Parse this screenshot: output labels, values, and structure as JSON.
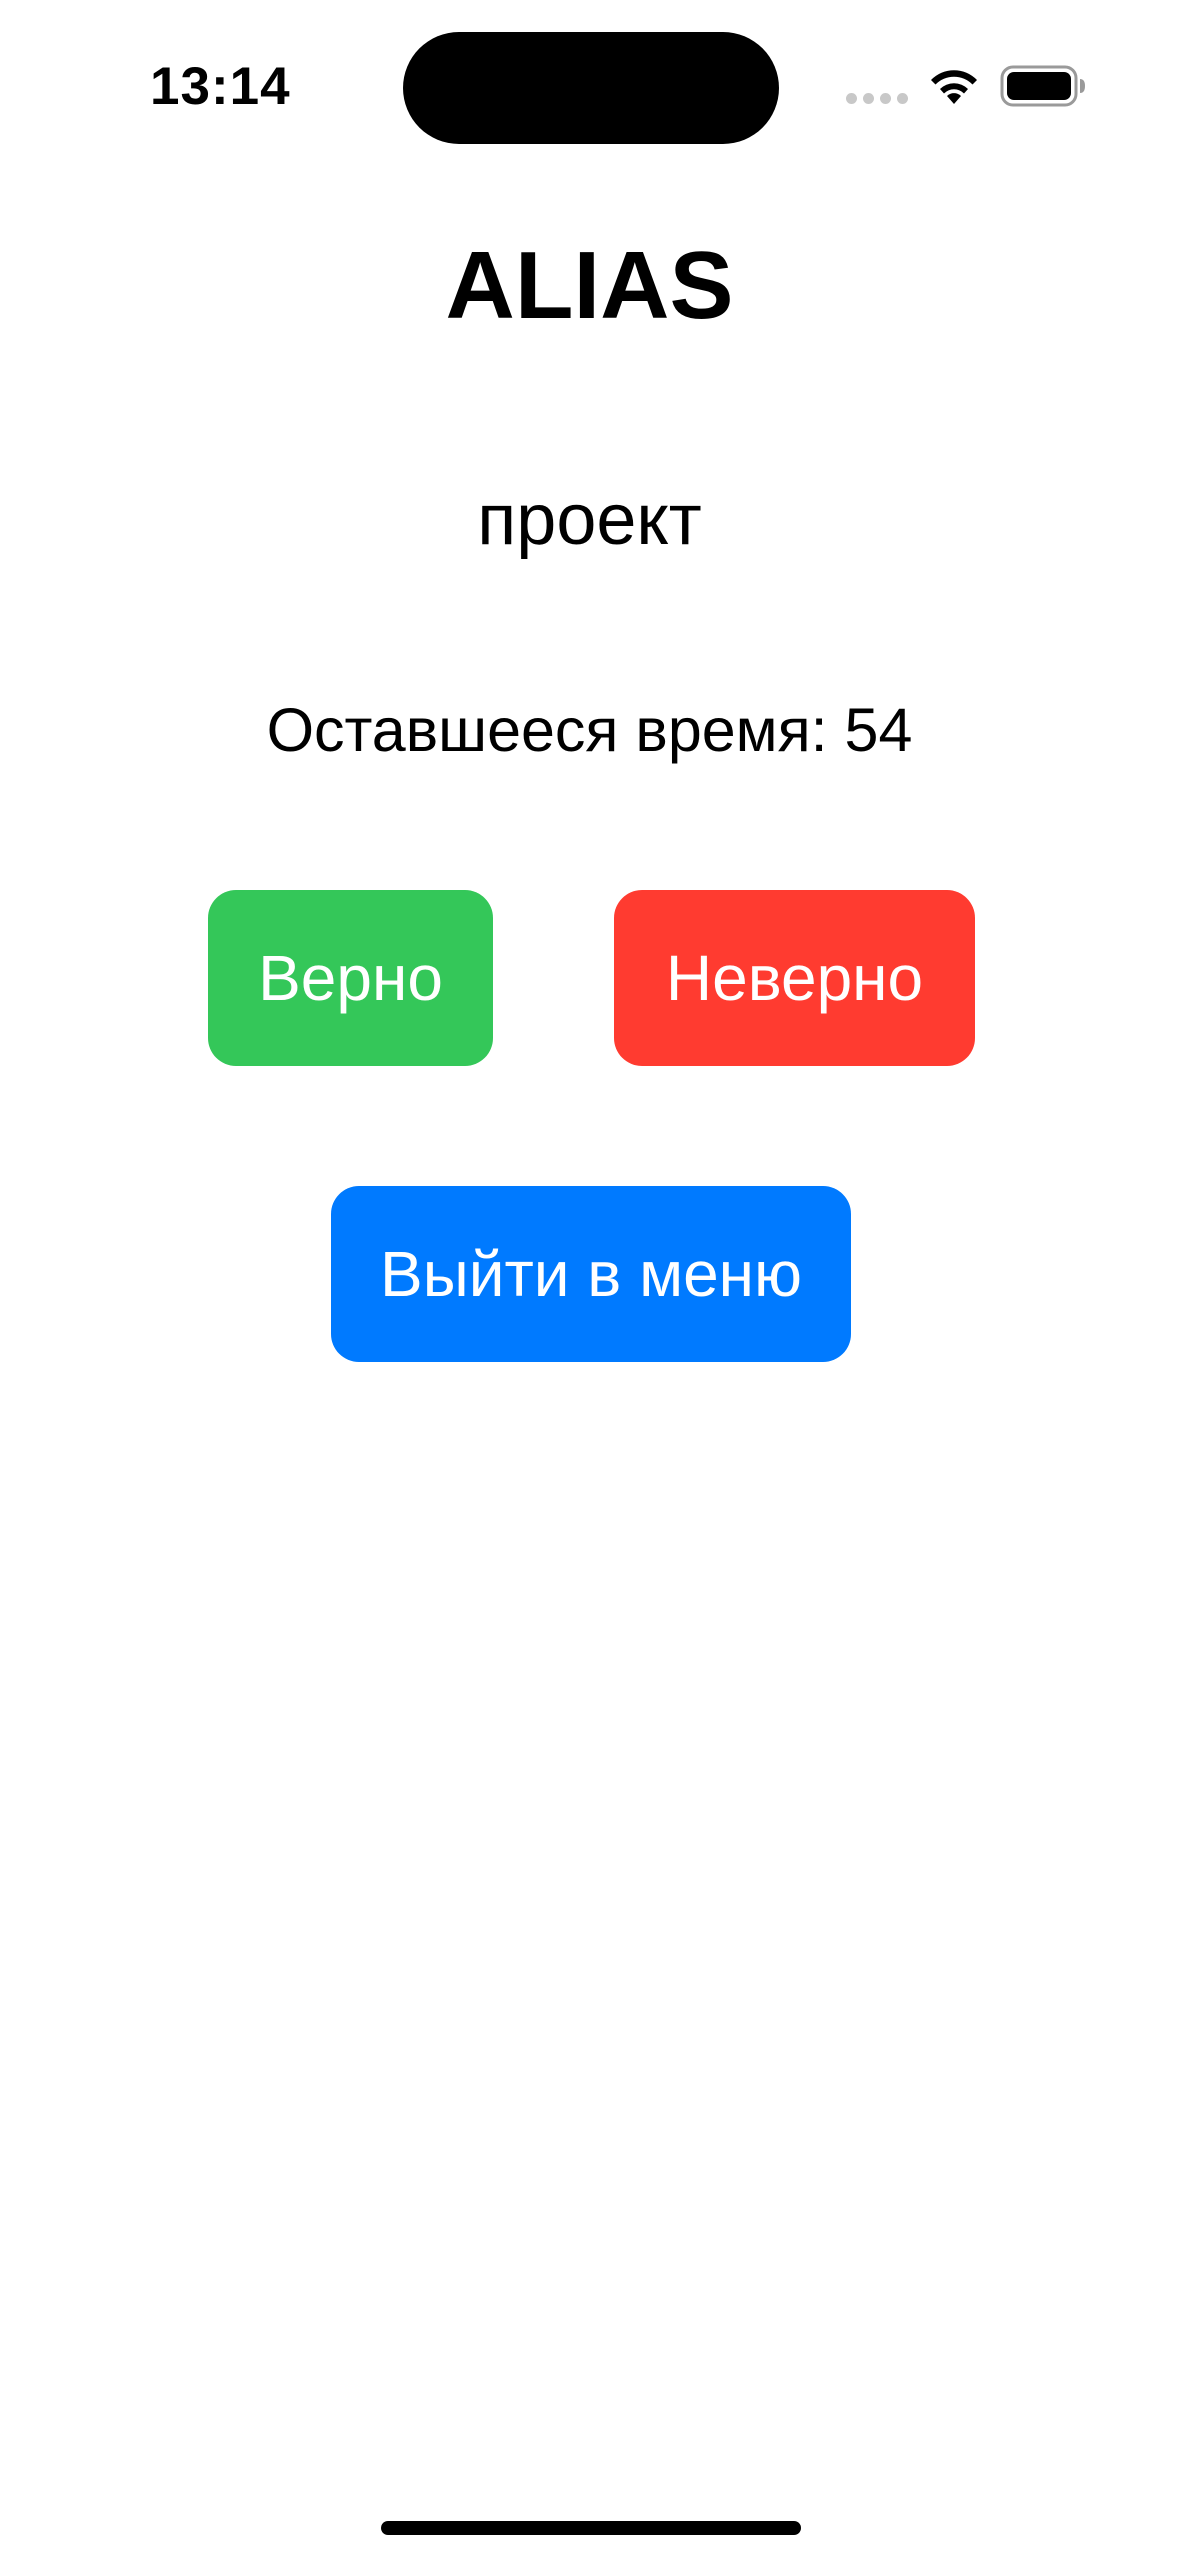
{
  "status_bar": {
    "time": "13:14",
    "icons": [
      "signal-icon",
      "wifi-icon",
      "battery-icon"
    ]
  },
  "screen": {
    "title": "ALIAS",
    "current_word": "проект",
    "timer_text": "Оставшееся время: 54"
  },
  "buttons": {
    "correct_label": "Верно",
    "wrong_label": "Неверно",
    "exit_label": "Выйти в меню"
  },
  "colors": {
    "correct": "#34c759",
    "wrong": "#ff3b30",
    "exit": "#007aff",
    "background": "#ffffff",
    "text": "#000000"
  }
}
